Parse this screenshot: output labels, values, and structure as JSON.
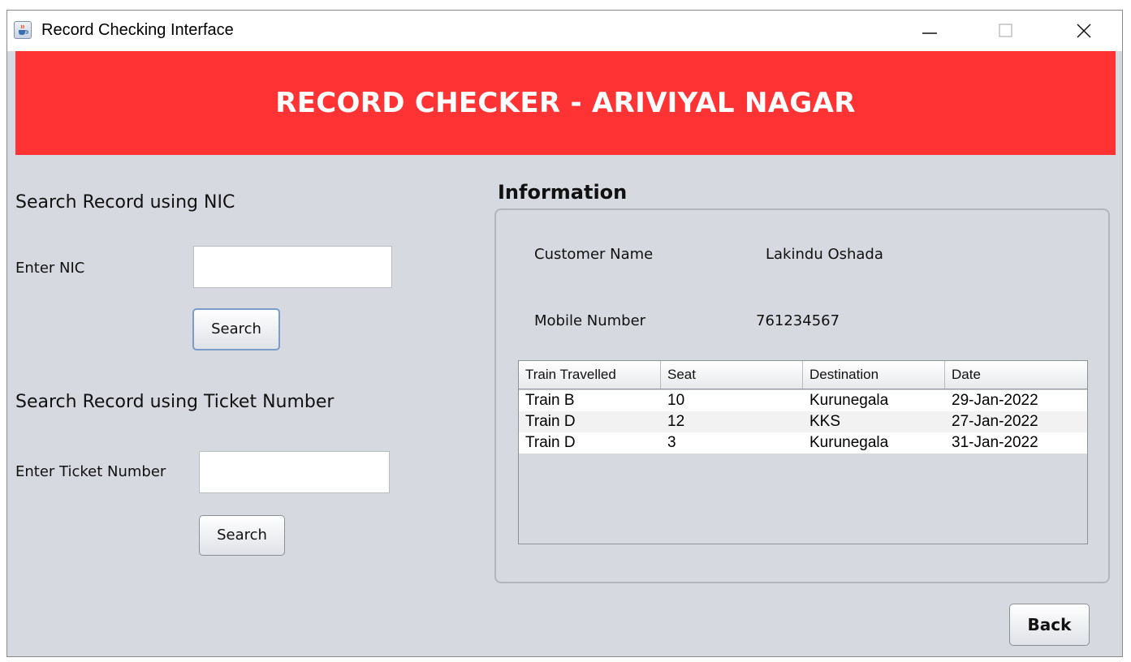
{
  "window": {
    "title": "Record Checking Interface",
    "icon": "java-coffee-cup-icon"
  },
  "banner": {
    "title": "RECORD CHECKER - ARIVIYAL NAGAR",
    "color": "#ff3333"
  },
  "nic_search": {
    "section_title": "Search Record using NIC",
    "label": "Enter NIC",
    "value": "",
    "button_label": "Search"
  },
  "ticket_search": {
    "section_title": "Search Record using Ticket Number",
    "label": "Enter Ticket Number",
    "value": "",
    "button_label": "Search"
  },
  "information": {
    "title": "Information",
    "customer_name_label": "Customer Name",
    "customer_name": "Lakindu Oshada",
    "mobile_label": "Mobile Number",
    "mobile": "761234567"
  },
  "table": {
    "columns": [
      "Train Travelled",
      "Seat",
      "Destination",
      "Date"
    ],
    "rows": [
      [
        "Train B",
        "10",
        "Kurunegala",
        "29-Jan-2022"
      ],
      [
        "Train D",
        "12",
        "KKS",
        "27-Jan-2022"
      ],
      [
        "Train D",
        "3",
        "Kurunegala",
        "31-Jan-2022"
      ]
    ]
  },
  "back_button": {
    "label": "Back"
  }
}
